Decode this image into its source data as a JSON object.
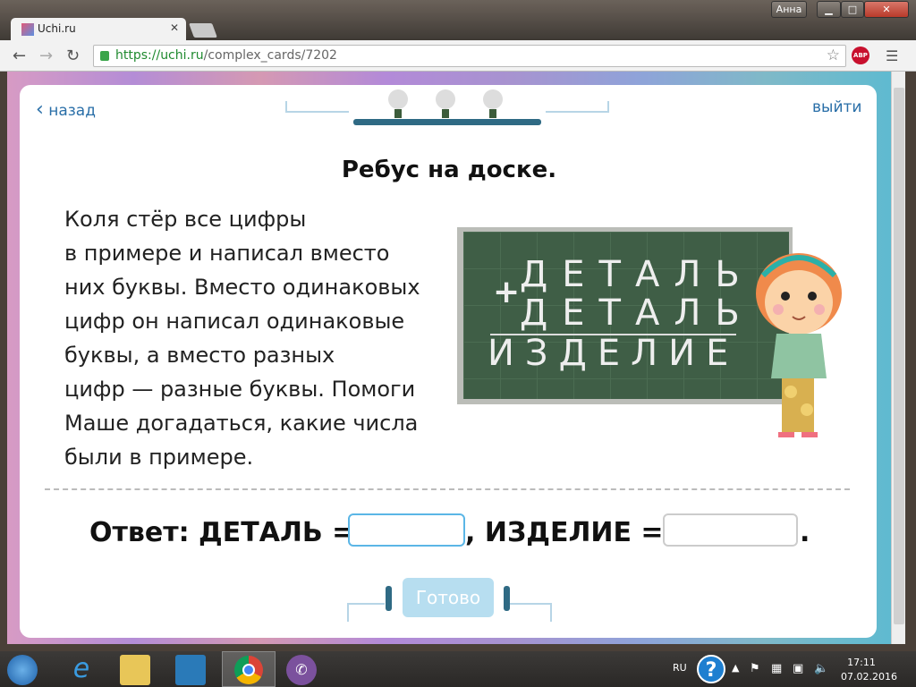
{
  "browser": {
    "tab_title": "Uchi.ru",
    "user": "Анна",
    "url_scheme": "https://",
    "url_host": "uchi.ru",
    "url_path": "/complex_cards/7202",
    "abp": "ABP"
  },
  "card": {
    "back": "назад",
    "exit": "выйти",
    "title": "Ребус на доске.",
    "task_lines": [
      "Коля стёр все цифры",
      "в примере и написал вместо",
      "них буквы. Вместо одинаковых",
      "цифр он написал одинаковые",
      "буквы, а вместо разных",
      "цифр — разные буквы. Помоги",
      "Маше догадаться, какие числа",
      "были в примере."
    ],
    "board": {
      "plus": "+",
      "row1": "ДЕТАЛЬ",
      "row2": "ДЕТАЛЬ",
      "result": "ИЗДЕЛИЕ"
    },
    "answer": {
      "label": "Ответ: ДЕТАЛЬ =",
      "middle": ", ИЗДЕЛИЕ =",
      "end": ".",
      "detal_value": "",
      "izdelie_value": ""
    },
    "done": "Готово"
  },
  "taskbar": {
    "lang": "RU",
    "time": "17:11",
    "date": "07.02.2016"
  }
}
